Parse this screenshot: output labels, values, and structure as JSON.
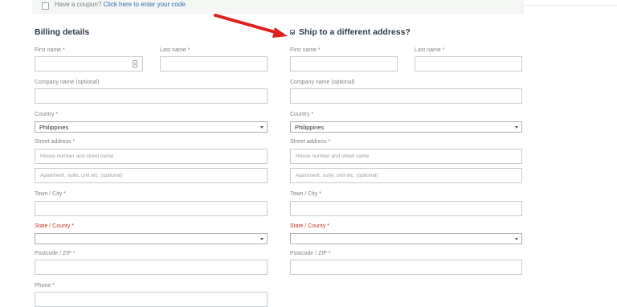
{
  "coupon": {
    "prompt": "Have a coupon?",
    "link": "Click here to enter your code"
  },
  "billing": {
    "heading": "Billing details",
    "first_name_label": "First name *",
    "last_name_label": "Last name *",
    "company_label": "Company name (optional)",
    "country_label": "Country *",
    "country_value": "Philippines",
    "street_label": "Street address *",
    "street_placeholder_1": "House number and street name",
    "street_placeholder_2": "Apartment, suite, unit etc. (optional)",
    "city_label": "Town / City *",
    "state_label": "State / County *",
    "postcode_label": "Postcode / ZIP *",
    "phone_label": "Phone *"
  },
  "shipping": {
    "heading": "Ship to a different address?",
    "checked": true,
    "first_name_label": "First name *",
    "last_name_label": "Last name *",
    "company_label": "Company name (optional)",
    "country_label": "Country *",
    "country_value": "Philippines",
    "street_label": "Street address *",
    "street_placeholder_1": "House number and street name",
    "street_placeholder_2": "Apartment, suite, unit etc. (optional)",
    "city_label": "Town / City *",
    "state_label": "State / County *",
    "postcode_label": "Postcode / ZIP *"
  },
  "colors": {
    "annotation_arrow": "#e0201b",
    "required_state_label": "#c0392b",
    "link": "#2f6fb4"
  },
  "icons": {
    "card": "card-icon",
    "caret": "chevron-down-icon",
    "arrow": "red-arrow-annotation"
  }
}
